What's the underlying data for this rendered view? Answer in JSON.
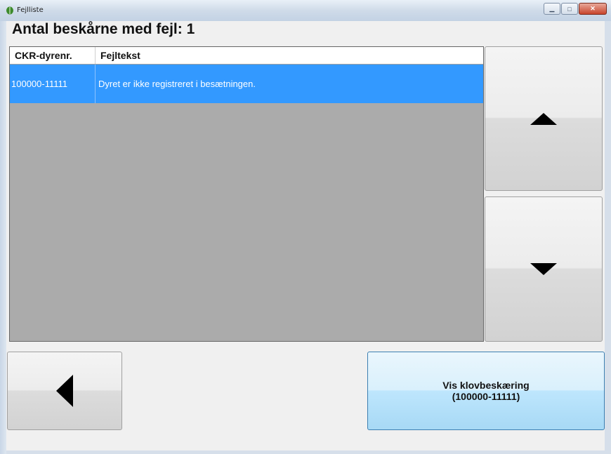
{
  "window": {
    "title": "Fejlliste",
    "minimize_glyph": "▁",
    "maximize_glyph": "□",
    "close_glyph": "✕",
    "app_icon": "leaf-icon"
  },
  "header": {
    "title": "Antal beskårne med fejl: 1"
  },
  "table": {
    "columns": [
      "CKR-dyrenr.",
      "Fejltekst"
    ],
    "rows": [
      {
        "id": "100000-11111",
        "text": "Dyret er ikke registreret i besætningen."
      }
    ],
    "selected_color": "#3399ff"
  },
  "buttons": {
    "up_icon": "triangle-up-icon",
    "down_icon": "triangle-down-icon",
    "back_icon": "triangle-left-icon",
    "show_line1": "Vis klovbeskæring",
    "show_line2": "(100000-11111)"
  }
}
